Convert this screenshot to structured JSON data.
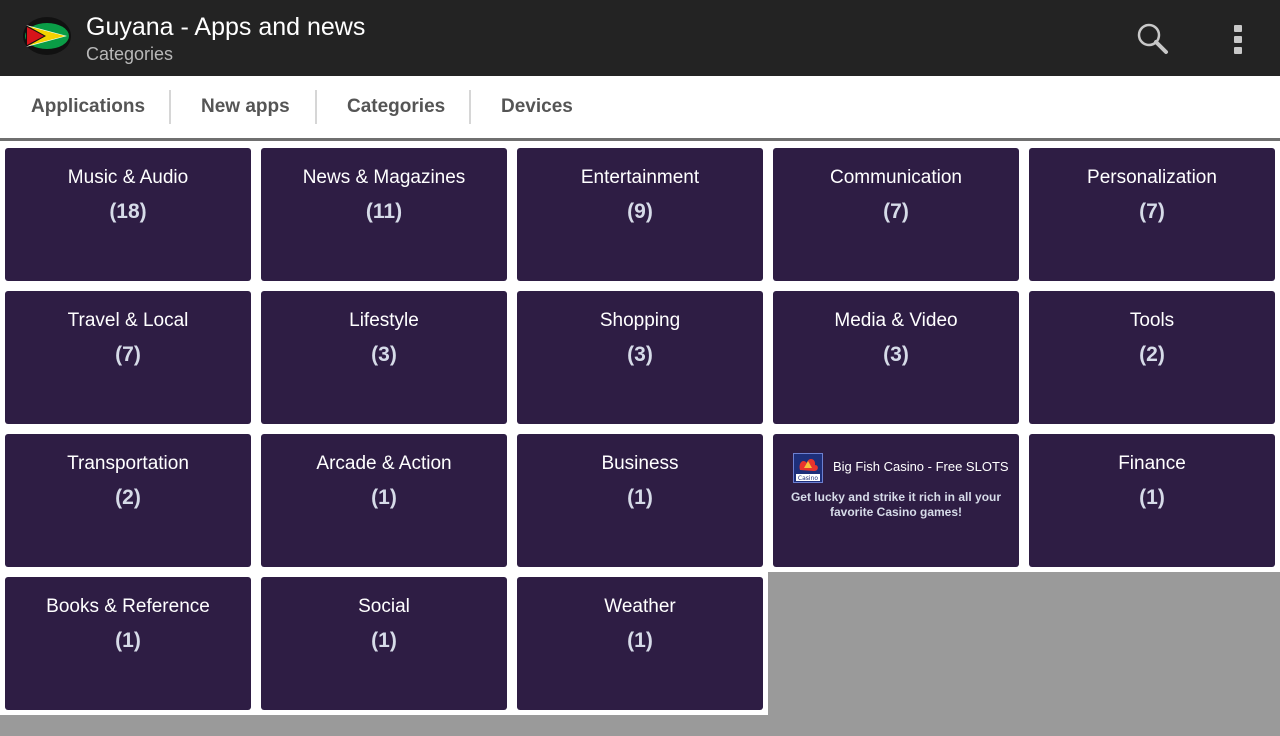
{
  "header": {
    "title": "Guyana - Apps and news",
    "subtitle": "Categories",
    "flag_icon": "guyana-flag-icon",
    "search_icon": "search-icon",
    "overflow_icon": "more-vertical-icon",
    "colors": {
      "bar": "#232323",
      "tile": "#2e1d44"
    }
  },
  "tabs": [
    {
      "label": "Applications"
    },
    {
      "label": "New apps"
    },
    {
      "label": "Categories"
    },
    {
      "label": "Devices"
    }
  ],
  "categories": [
    {
      "name": "Music & Audio",
      "count": "(18)"
    },
    {
      "name": "News & Magazines",
      "count": "(11)"
    },
    {
      "name": "Entertainment",
      "count": "(9)"
    },
    {
      "name": "Communication",
      "count": "(7)"
    },
    {
      "name": "Personalization",
      "count": "(7)"
    },
    {
      "name": "Travel & Local",
      "count": "(7)"
    },
    {
      "name": "Lifestyle",
      "count": "(3)"
    },
    {
      "name": "Shopping",
      "count": "(3)"
    },
    {
      "name": "Media & Video",
      "count": "(3)"
    },
    {
      "name": "Tools",
      "count": "(2)"
    },
    {
      "name": "Transportation",
      "count": "(2)"
    },
    {
      "name": "Arcade & Action",
      "count": "(1)"
    },
    {
      "name": "Business",
      "count": "(1)"
    },
    {
      "name": "Finance",
      "count": "(1)"
    },
    {
      "name": "Books & Reference",
      "count": "(1)"
    },
    {
      "name": "Social",
      "count": "(1)"
    },
    {
      "name": "Weather",
      "count": "(1)"
    }
  ],
  "ad": {
    "title": "Big Fish Casino - Free SLOTS",
    "text": "Get lucky and strike it rich in all your favorite Casino games!",
    "icon": "casino-app-icon",
    "icon_caption": "Casino"
  }
}
